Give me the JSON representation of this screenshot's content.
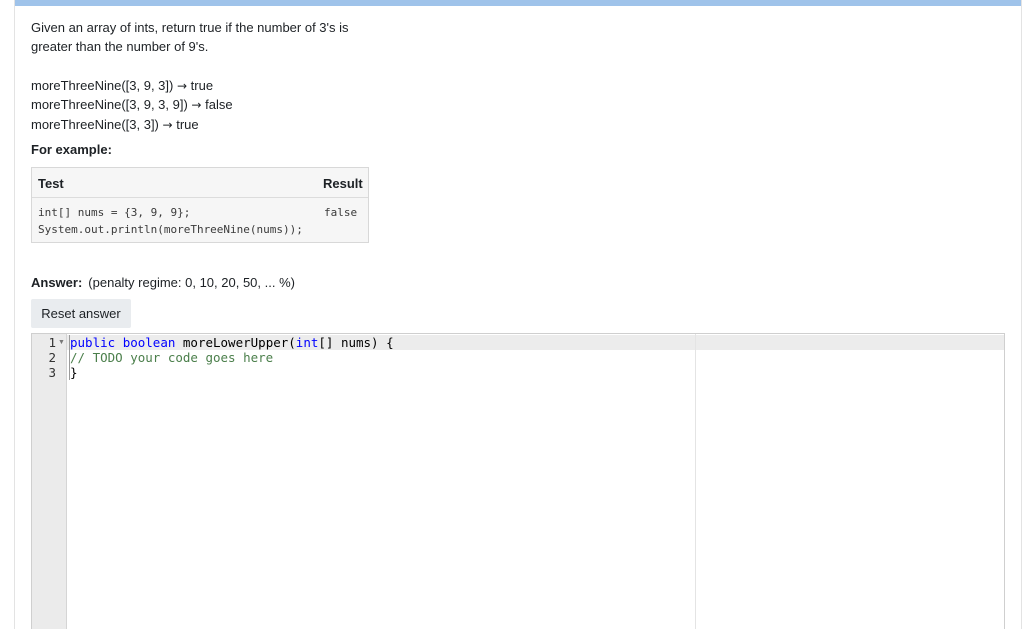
{
  "question": {
    "text_line1": "Given an array of ints, return true if the number of 3's is",
    "text_line2": "greater than the number of 9's.",
    "examples": [
      {
        "call": "moreThreeNine([3, 9, 3])",
        "arrow": "→",
        "result": "true"
      },
      {
        "call": "moreThreeNine([3, 9, 3, 9])",
        "arrow": "→",
        "result": "false"
      },
      {
        "call": "moreThreeNine([3, 3])",
        "arrow": "→",
        "result": "true"
      }
    ],
    "for_example_label": "For example:"
  },
  "test_table": {
    "headers": {
      "test": "Test",
      "result": "Result"
    },
    "rows": [
      {
        "test_line1": "int[] nums = {3, 9, 9};",
        "test_line2": "System.out.println(moreThreeNine(nums));",
        "result": "false"
      }
    ]
  },
  "answer": {
    "label": "Answer:",
    "penalty": "(penalty regime: 0, 10, 20, 50, ... %)",
    "reset_button": "Reset answer"
  },
  "editor": {
    "line_numbers": [
      "1",
      "2",
      "3"
    ],
    "lines": {
      "l1_kw1": "public",
      "l1_kw2": "boolean",
      "l1_name": "moreLowerUpper(",
      "l1_kw3": "int",
      "l1_rest": "[] nums) {",
      "l2_comment": "// TODO your code goes here",
      "l3": "}"
    },
    "fold_icon": "fold-arrow-icon"
  }
}
